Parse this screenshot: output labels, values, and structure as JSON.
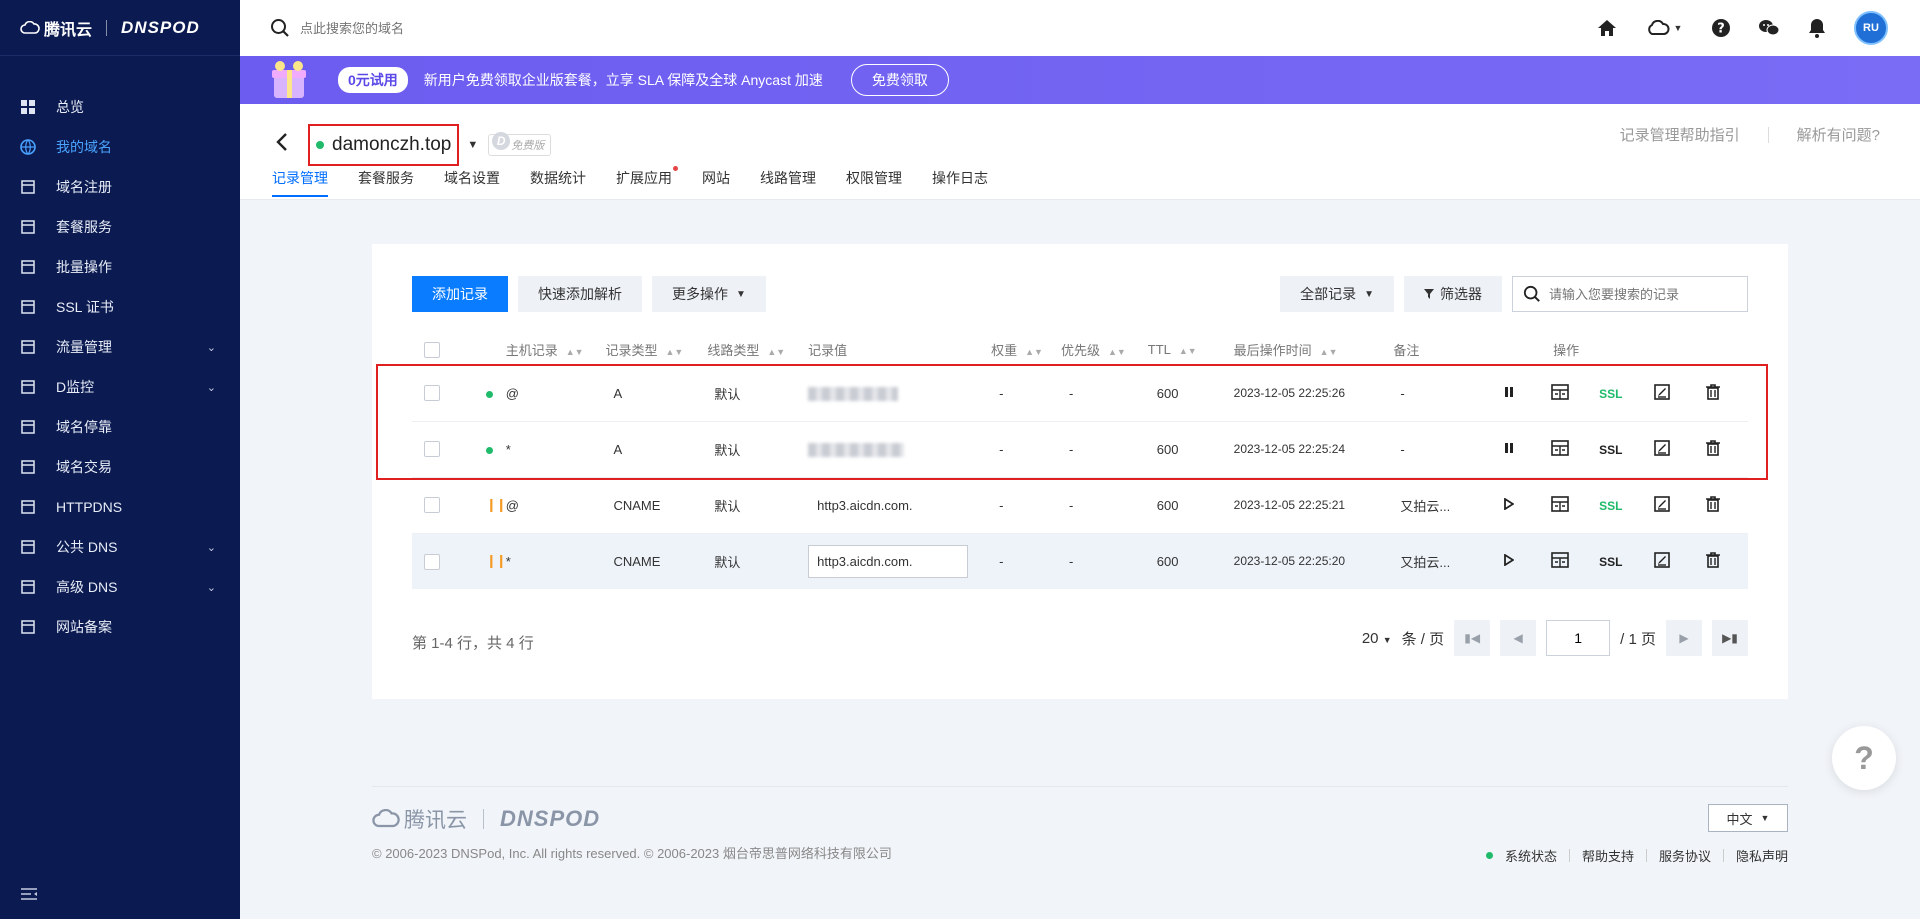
{
  "sidebar": {
    "brand": "腾讯云",
    "product": "DNSPOD",
    "items": [
      {
        "label": "总览",
        "icon": "dashboard-icon",
        "chevron": false
      },
      {
        "label": "我的域名",
        "icon": "globe-icon",
        "chevron": false,
        "active": true
      },
      {
        "label": "域名注册",
        "icon": "register-icon",
        "chevron": false
      },
      {
        "label": "套餐服务",
        "icon": "package-icon",
        "chevron": false
      },
      {
        "label": "批量操作",
        "icon": "batch-icon",
        "chevron": false
      },
      {
        "label": "SSL 证书",
        "icon": "certificate-icon",
        "chevron": false
      },
      {
        "label": "流量管理",
        "icon": "traffic-icon",
        "chevron": true
      },
      {
        "label": "D监控",
        "icon": "monitor-icon",
        "chevron": true
      },
      {
        "label": "域名停靠",
        "icon": "parking-icon",
        "chevron": false
      },
      {
        "label": "域名交易",
        "icon": "trade-icon",
        "chevron": false
      },
      {
        "label": "HTTPDNS",
        "icon": "httpdns-icon",
        "chevron": false
      },
      {
        "label": "公共 DNS",
        "icon": "public-dns-icon",
        "chevron": true
      },
      {
        "label": "高级 DNS",
        "icon": "advanced-dns-icon",
        "chevron": true
      },
      {
        "label": "网站备案",
        "icon": "filing-icon",
        "chevron": false
      }
    ]
  },
  "topbar": {
    "search_placeholder": "点此搜索您的域名",
    "avatar_text": "RU"
  },
  "banner": {
    "badge": "0元试用",
    "text": "新用户免费领取企业版套餐，立享 SLA 保障及全球 Anycast 加速",
    "button": "免费领取"
  },
  "domain": {
    "name": "damonczh.top",
    "plan_badge": "免费版",
    "help_link": "记录管理帮助指引",
    "issue_link": "解析有问题?",
    "tabs": [
      "记录管理",
      "套餐服务",
      "域名设置",
      "数据统计",
      "扩展应用",
      "网站",
      "线路管理",
      "权限管理",
      "操作日志"
    ]
  },
  "toolbar": {
    "add_record": "添加记录",
    "quick_add": "快速添加解析",
    "more_ops": "更多操作",
    "all_records": "全部记录",
    "filter": "筛选器",
    "search_placeholder": "请输入您要搜索的记录"
  },
  "table": {
    "headers": {
      "host": "主机记录",
      "type": "记录类型",
      "line": "线路类型",
      "value": "记录值",
      "weight": "权重",
      "priority": "优先级",
      "ttl": "TTL",
      "time": "最后操作时间",
      "remark": "备注",
      "action": "操作"
    },
    "rows": [
      {
        "status": "enabled",
        "host": "@",
        "type": "A",
        "line": "默认",
        "value": "",
        "weight": "-",
        "priority": "-",
        "ttl": "600",
        "time": "2023-12-05 22:25:26",
        "remark": "-",
        "ssl": "SSL",
        "ssl_active": true
      },
      {
        "status": "enabled",
        "host": "*",
        "type": "A",
        "line": "默认",
        "value": "",
        "weight": "-",
        "priority": "-",
        "ttl": "600",
        "time": "2023-12-05 22:25:24",
        "remark": "-",
        "ssl": "SSL",
        "ssl_active": false
      },
      {
        "status": "paused",
        "host": "@",
        "type": "CNAME",
        "line": "默认",
        "value": "http3.aicdn.com.",
        "weight": "-",
        "priority": "-",
        "ttl": "600",
        "time": "2023-12-05 22:25:21",
        "remark": "又拍云...",
        "ssl": "SSL",
        "ssl_active": true
      },
      {
        "status": "paused",
        "host": "*",
        "type": "CNAME",
        "line": "默认",
        "value": "http3.aicdn.com.",
        "weight": "-",
        "priority": "-",
        "ttl": "600",
        "time": "2023-12-05 22:25:20",
        "remark": "又拍云...",
        "ssl": "SSL",
        "ssl_active": false
      }
    ]
  },
  "pagination": {
    "summary": "第 1-4 行，共 4 行",
    "page_size": "20",
    "page_size_unit": "条 / 页",
    "current_page": "1",
    "total_pages": "/ 1 页"
  },
  "footer": {
    "brand": "腾讯云",
    "product": "DNSPOD",
    "copyright": "© 2006-2023 DNSPod, Inc. All rights reserved. © 2006-2023 烟台帝思普网络科技有限公司",
    "language": "中文",
    "links": [
      "系统状态",
      "帮助支持",
      "服务协议",
      "隐私声明"
    ]
  },
  "help_fab": "?",
  "colors": {
    "sidebar_bg": "#0b1b52",
    "primary": "#0a7cff",
    "enabled": "#1fba6a",
    "paused": "#f59a23",
    "highlight_border": "#e02020"
  }
}
